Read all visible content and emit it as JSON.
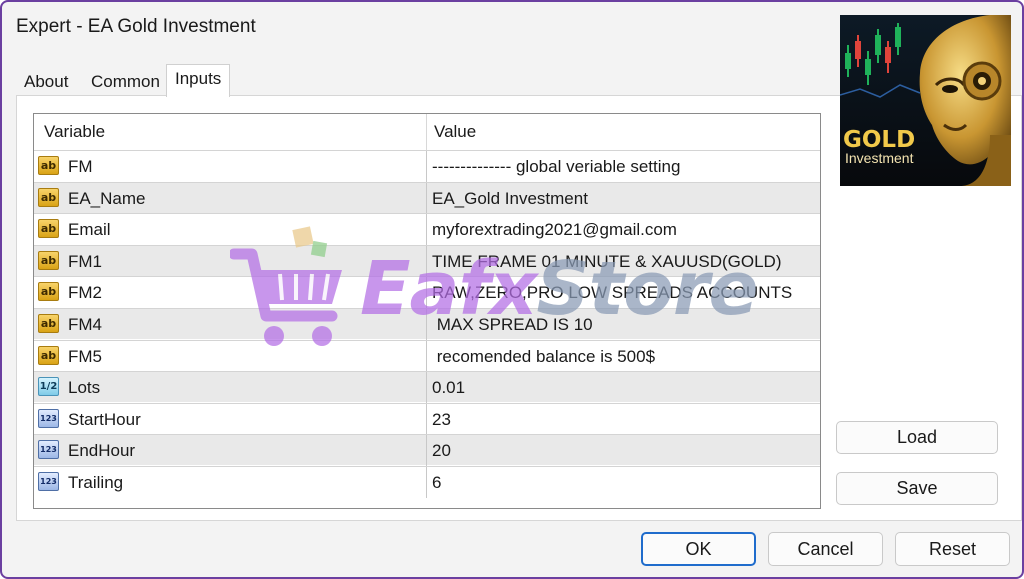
{
  "window": {
    "title": "Expert - EA Gold Investment"
  },
  "tabs": [
    {
      "label": "About"
    },
    {
      "label": "Common"
    },
    {
      "label": "Inputs"
    }
  ],
  "grid": {
    "headers": {
      "variable": "Variable",
      "value": "Value"
    },
    "rows": [
      {
        "icon": "ab",
        "variable": "FM",
        "value": "-------------- global veriable setting"
      },
      {
        "icon": "ab",
        "variable": "EA_Name",
        "value": "EA_Gold Investment"
      },
      {
        "icon": "ab",
        "variable": "Email",
        "value": "myforextrading2021@gmail.com"
      },
      {
        "icon": "ab",
        "variable": "FM1",
        "value": "TIME FRAME 01 MINUTE & XAUUSD(GOLD)"
      },
      {
        "icon": "ab",
        "variable": "FM2",
        "value": "RAW,ZERO,PRO LOW SPREADS ACCOUNTS"
      },
      {
        "icon": "ab",
        "variable": "FM4",
        "value": " MAX SPREAD IS 10"
      },
      {
        "icon": "ab",
        "variable": "FM5",
        "value": " recomended balance is 500$"
      },
      {
        "icon": "1/2",
        "variable": "Lots",
        "value": "0.01"
      },
      {
        "icon": "123",
        "variable": "StartHour",
        "value": "23"
      },
      {
        "icon": "123",
        "variable": "EndHour",
        "value": "20"
      },
      {
        "icon": "123",
        "variable": "Trailing",
        "value": "6"
      }
    ]
  },
  "watermark": {
    "part1": "Eafx",
    "part2": "Store"
  },
  "product_image": {
    "title": "GOLD",
    "subtitle": "Investment"
  },
  "buttons": {
    "load": "Load",
    "save": "Save",
    "ok": "OK",
    "cancel": "Cancel",
    "reset": "Reset"
  },
  "icons": {
    "string": "ab-icon",
    "double": "half-icon",
    "integer": "123-icon"
  },
  "colors": {
    "accent": "#1f6ccc",
    "frame": "#6b3fa0",
    "string_icon": "#d9a316"
  }
}
